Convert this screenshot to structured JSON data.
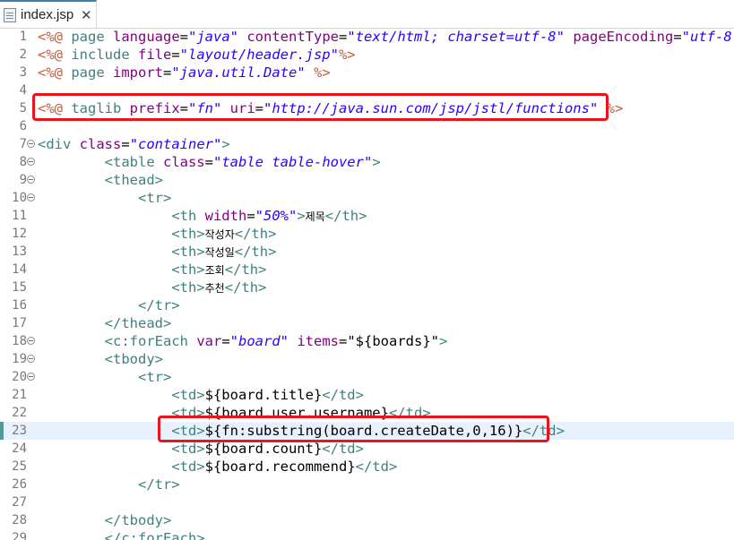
{
  "tab": {
    "title": "index.jsp",
    "close": "✕"
  },
  "lines": [
    {
      "n": "1",
      "parts": [
        [
          "dir",
          "<%@ "
        ],
        [
          "kw",
          "page "
        ],
        [
          "attr",
          "language"
        ],
        [
          "el",
          "="
        ],
        [
          "val",
          "\"java\""
        ],
        [
          "el",
          " "
        ],
        [
          "attr",
          "contentType"
        ],
        [
          "el",
          "="
        ],
        [
          "val",
          "\"text/html; charset=utf-8\""
        ],
        [
          "el",
          " "
        ],
        [
          "attr",
          "pageEncoding"
        ],
        [
          "el",
          "="
        ],
        [
          "val",
          "\"utf-8\""
        ],
        [
          "dir",
          "%>"
        ]
      ]
    },
    {
      "n": "2",
      "parts": [
        [
          "dir",
          "<%@ "
        ],
        [
          "kw",
          "include "
        ],
        [
          "attr",
          "file"
        ],
        [
          "el",
          "="
        ],
        [
          "val",
          "\"layout/header.jsp\""
        ],
        [
          "dir",
          "%>"
        ]
      ]
    },
    {
      "n": "3",
      "parts": [
        [
          "dir",
          "<%@ "
        ],
        [
          "kw",
          "page "
        ],
        [
          "attr",
          "import"
        ],
        [
          "el",
          "="
        ],
        [
          "val",
          "\"java.util.Date\""
        ],
        [
          "el",
          " "
        ],
        [
          "dir",
          "%>"
        ]
      ]
    },
    {
      "n": "4",
      "parts": []
    },
    {
      "n": "5",
      "parts": [
        [
          "dir",
          "<%@ "
        ],
        [
          "kw",
          "taglib "
        ],
        [
          "attr",
          "prefix"
        ],
        [
          "el",
          "="
        ],
        [
          "val",
          "\"fn\""
        ],
        [
          "el",
          " "
        ],
        [
          "attr",
          "uri"
        ],
        [
          "el",
          "="
        ],
        [
          "val",
          "\"http://java.sun.com/jsp/jstl/functions\""
        ],
        [
          "el",
          " "
        ],
        [
          "dir",
          "%>"
        ]
      ]
    },
    {
      "n": "6",
      "parts": []
    },
    {
      "n": "7",
      "fold": true,
      "parts": [
        [
          "tag",
          "<div "
        ],
        [
          "attr",
          "class"
        ],
        [
          "el",
          "="
        ],
        [
          "val",
          "\"container\""
        ],
        [
          "tag",
          ">"
        ]
      ]
    },
    {
      "n": "8",
      "fold": true,
      "parts": [
        [
          "el",
          "        "
        ],
        [
          "tag",
          "<table "
        ],
        [
          "attr",
          "class"
        ],
        [
          "el",
          "="
        ],
        [
          "val",
          "\"table table-hover\""
        ],
        [
          "tag",
          ">"
        ]
      ]
    },
    {
      "n": "9",
      "fold": true,
      "parts": [
        [
          "el",
          "        "
        ],
        [
          "tag",
          "<thead>"
        ]
      ]
    },
    {
      "n": "10",
      "fold": true,
      "parts": [
        [
          "el",
          "            "
        ],
        [
          "tag",
          "<tr>"
        ]
      ]
    },
    {
      "n": "11",
      "parts": [
        [
          "el",
          "                "
        ],
        [
          "tag",
          "<th "
        ],
        [
          "attr",
          "width"
        ],
        [
          "el",
          "="
        ],
        [
          "val",
          "\"50%\""
        ],
        [
          "tag",
          ">"
        ],
        [
          "ko",
          "제목"
        ],
        [
          "tag",
          "</th>"
        ]
      ]
    },
    {
      "n": "12",
      "parts": [
        [
          "el",
          "                "
        ],
        [
          "tag",
          "<th>"
        ],
        [
          "ko",
          "작성자"
        ],
        [
          "tag",
          "</th>"
        ]
      ]
    },
    {
      "n": "13",
      "parts": [
        [
          "el",
          "                "
        ],
        [
          "tag",
          "<th>"
        ],
        [
          "ko",
          "작성일"
        ],
        [
          "tag",
          "</th>"
        ]
      ]
    },
    {
      "n": "14",
      "parts": [
        [
          "el",
          "                "
        ],
        [
          "tag",
          "<th>"
        ],
        [
          "ko",
          "조회"
        ],
        [
          "tag",
          "</th>"
        ]
      ]
    },
    {
      "n": "15",
      "parts": [
        [
          "el",
          "                "
        ],
        [
          "tag",
          "<th>"
        ],
        [
          "ko",
          "추천"
        ],
        [
          "tag",
          "</th>"
        ]
      ]
    },
    {
      "n": "16",
      "parts": [
        [
          "el",
          "            "
        ],
        [
          "tag",
          "</tr>"
        ]
      ]
    },
    {
      "n": "17",
      "parts": [
        [
          "el",
          "        "
        ],
        [
          "tag",
          "</thead>"
        ]
      ]
    },
    {
      "n": "18",
      "fold": true,
      "parts": [
        [
          "el",
          "        "
        ],
        [
          "tag",
          "<c:forEach "
        ],
        [
          "attr",
          "var"
        ],
        [
          "el",
          "="
        ],
        [
          "val",
          "\"board\""
        ],
        [
          "el",
          " "
        ],
        [
          "attr",
          "items"
        ],
        [
          "el",
          "=\"${boards}\""
        ],
        [
          "tag",
          ">"
        ]
      ]
    },
    {
      "n": "19",
      "fold": true,
      "parts": [
        [
          "el",
          "        "
        ],
        [
          "tag",
          "<tbody>"
        ]
      ]
    },
    {
      "n": "20",
      "fold": true,
      "parts": [
        [
          "el",
          "            "
        ],
        [
          "tag",
          "<tr>"
        ]
      ]
    },
    {
      "n": "21",
      "parts": [
        [
          "el",
          "                "
        ],
        [
          "tag",
          "<td>"
        ],
        [
          "el",
          "${board.title}"
        ],
        [
          "tag",
          "</td>"
        ]
      ]
    },
    {
      "n": "22",
      "parts": [
        [
          "el",
          "                "
        ],
        [
          "tag",
          "<td>"
        ],
        [
          "el",
          "${board.user.username}"
        ],
        [
          "tag",
          "</td>"
        ]
      ]
    },
    {
      "n": "23",
      "current": true,
      "parts": [
        [
          "el",
          "                "
        ],
        [
          "tag",
          "<td>"
        ],
        [
          "el",
          "${fn:substring(board.createDate,0,16)}"
        ],
        [
          "tag",
          "</td>"
        ]
      ]
    },
    {
      "n": "24",
      "parts": [
        [
          "el",
          "                "
        ],
        [
          "tag",
          "<td>"
        ],
        [
          "el",
          "${board.count}"
        ],
        [
          "tag",
          "</td>"
        ]
      ]
    },
    {
      "n": "25",
      "parts": [
        [
          "el",
          "                "
        ],
        [
          "tag",
          "<td>"
        ],
        [
          "el",
          "${board.recommend}"
        ],
        [
          "tag",
          "</td>"
        ]
      ]
    },
    {
      "n": "26",
      "parts": [
        [
          "el",
          "            "
        ],
        [
          "tag",
          "</tr>"
        ]
      ]
    },
    {
      "n": "27",
      "parts": []
    },
    {
      "n": "28",
      "parts": [
        [
          "el",
          "        "
        ],
        [
          "tag",
          "</tbody>"
        ]
      ]
    },
    {
      "n": "29",
      "parts": [
        [
          "el",
          "        "
        ],
        [
          "tag",
          "</c:forEach>"
        ]
      ]
    }
  ]
}
